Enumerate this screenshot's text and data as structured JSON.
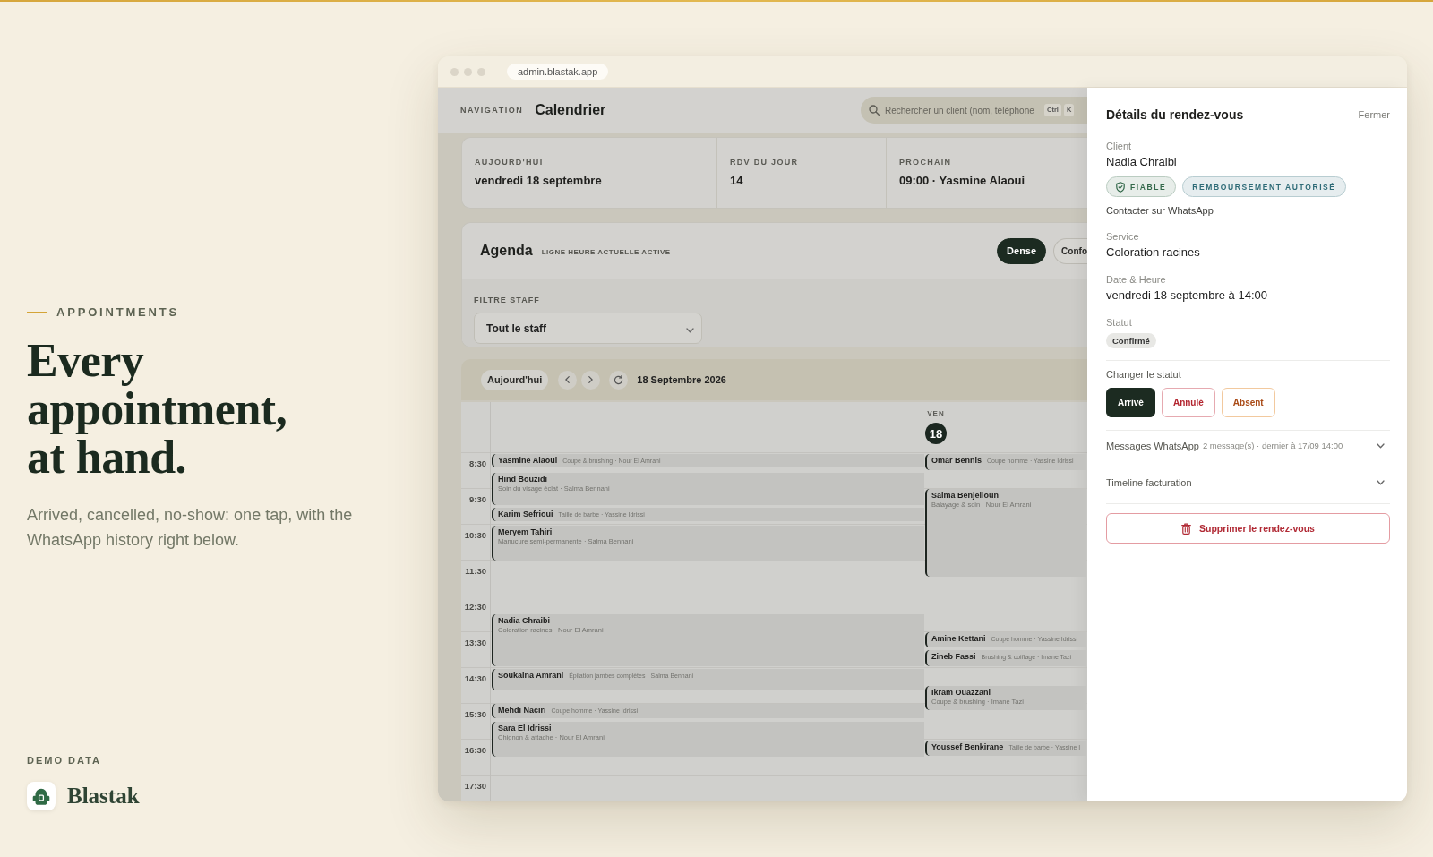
{
  "hero": {
    "eyebrow": "APPOINTMENTS",
    "heading": "Every appointment, at hand.",
    "description": "Arrived, cancelled, no-show: one tap, with the WhatsApp history right below.",
    "demo_label": "DEMO DATA",
    "brand": "Blastak"
  },
  "browser": {
    "url": "admin.blastak.app"
  },
  "header": {
    "nav_label": "NAVIGATION",
    "title": "Calendrier",
    "search": {
      "placeholder": "Rechercher un client (nom, téléphone",
      "shortcut": [
        "Ctrl",
        "K"
      ]
    }
  },
  "stats": [
    {
      "label": "AUJOURD'HUI",
      "value": "vendredi 18 septembre"
    },
    {
      "label": "RDV DU JOUR",
      "value": "14"
    },
    {
      "label": "PROCHAIN",
      "value": "09:00 · Yasmine Alaoui"
    }
  ],
  "agenda": {
    "title": "Agenda",
    "caption": "LIGNE HEURE ACTUELLE ACTIVE",
    "views": [
      {
        "label": "Dense",
        "selected": true
      },
      {
        "label": "Confo",
        "selected": false
      }
    ],
    "filter": {
      "label": "FILTRE STAFF",
      "value": "Tout le staff"
    }
  },
  "toolbar": {
    "today": "Aujourd'hui",
    "date": "18 Septembre 2026"
  },
  "calendar": {
    "day": {
      "weekday": "VEN",
      "number": "18"
    },
    "times": [
      "8:30",
      "9:30",
      "10:30",
      "11:30",
      "12:30",
      "13:30",
      "14:30",
      "15:30",
      "16:30",
      "17:30"
    ],
    "lanes": [
      {
        "events": [
          {
            "client": "Yasmine Alaoui",
            "detail": "Coupe & brushing · Nour El Amrani"
          },
          {
            "client": "Hind Bouzidi",
            "detail": "Soin du visage éclat · Salma Bennani"
          },
          {
            "client": "Karim Sefrioui",
            "detail": "Taille de barbe · Yassine Idrissi"
          },
          {
            "client": "Meryem Tahiri",
            "detail": "Manucure semi-permanente · Salma Bennani"
          },
          {
            "client": "Nadia Chraibi",
            "detail": "Coloration racines · Nour El Amrani"
          },
          {
            "client": "Soukaina Amrani",
            "detail": "Épilation jambes complètes · Salma Bennani"
          },
          {
            "client": "Mehdi Naciri",
            "detail": "Coupe homme · Yassine Idrissi"
          },
          {
            "client": "Sara El Idrissi",
            "detail": "Chignon & attache · Nour El Amrani"
          }
        ]
      },
      {
        "events": [
          {
            "client": "Omar Bennis",
            "detail": "Coupe homme · Yassine Idrissi"
          },
          {
            "client": "Salma Benjelloun",
            "detail": "Balayage & soin · Nour El Amrani"
          },
          {
            "client": "Amine Kettani",
            "detail": "Coupe homme · Yassine Idrissi"
          },
          {
            "client": "Zineb Fassi",
            "detail": "Brushing & coiffage · Imane Tazi"
          },
          {
            "client": "Ikram Ouazzani",
            "detail": "Coupe & brushing · Imane Tazi"
          },
          {
            "client": "Youssef Benkirane",
            "detail": "Taille de barbe · Yassine I"
          }
        ]
      }
    ]
  },
  "details": {
    "title": "Détails du rendez-vous",
    "close": "Fermer",
    "client": {
      "label": "Client",
      "name": "Nadia Chraibi",
      "tags": [
        {
          "label": "FIABLE",
          "kind": "trust",
          "color": "#33684a"
        },
        {
          "label": "REMBOURSEMENT AUTORISÉ",
          "kind": "policy",
          "color": "#2e6b77"
        }
      ],
      "contact": "Contacter sur WhatsApp"
    },
    "fields": [
      {
        "label": "Service",
        "value": "Coloration racines"
      },
      {
        "label": "Date & Heure",
        "value": "vendredi 18 septembre à 14:00"
      }
    ],
    "status": {
      "label": "Statut",
      "value": "Confirmé"
    },
    "change": {
      "label": "Changer le statut",
      "actions": [
        {
          "label": "Arrivé",
          "kind": "primary"
        },
        {
          "label": "Annulé",
          "kind": "danger"
        },
        {
          "label": "Absent",
          "kind": "warning"
        }
      ]
    },
    "sections": [
      {
        "title": "Messages WhatsApp",
        "summary": "2 message(s) · dernier à 17/09 14:00",
        "expanded": false
      },
      {
        "title": "Timeline facturation",
        "expanded": false
      }
    ],
    "delete": "Supprimer le rendez-vous"
  }
}
